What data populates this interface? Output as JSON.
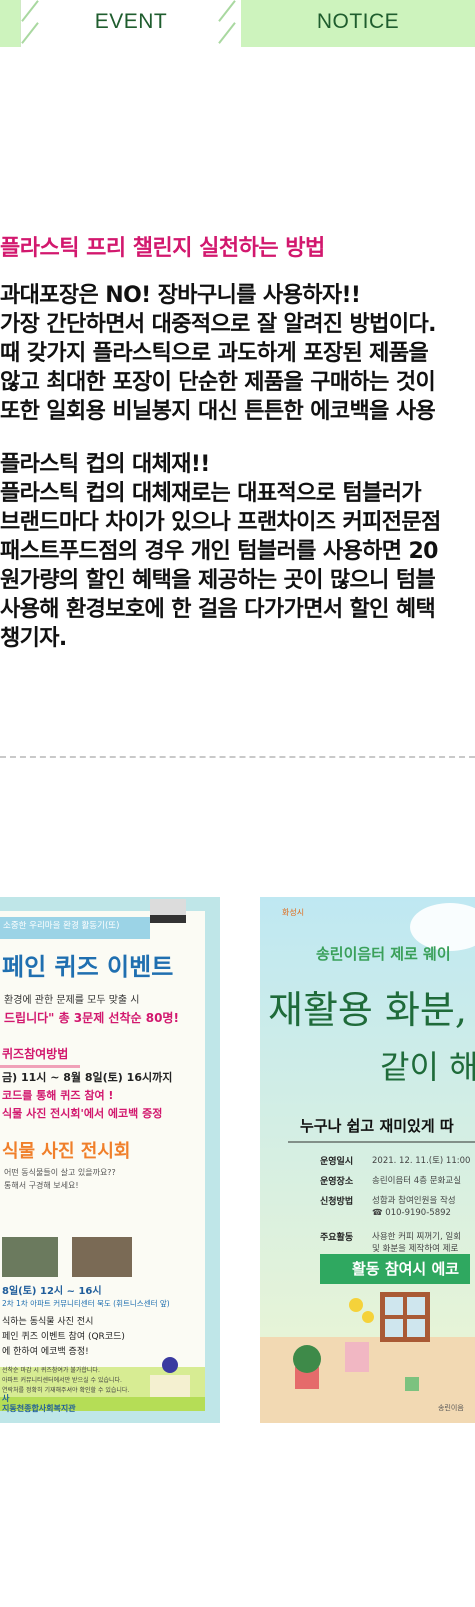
{
  "tabs": [
    {
      "label": "EVENT"
    },
    {
      "label": "NOTICE"
    }
  ],
  "article": {
    "title": "플라스틱 프리 챌린지 실천하는 방법",
    "paragraph1": [
      "과대포장은 NO! 장바구니를 사용하자!!",
      "가장 간단하면서 대중적으로 잘 알려진 방법이다.",
      "때 갖가지 플라스틱으로 과도하게 포장된 제품을",
      "않고 최대한 포장이 단순한 제품을 구매하는 것이",
      "또한 일회용 비닐봉지 대신 튼튼한 에코백을 사용"
    ],
    "paragraph2": [
      "플라스틱 컵의 대체재!!",
      "플라스틱 컵의 대체재로는 대표적으로 텀블러가",
      "브랜드마다 차이가 있으나 프랜차이즈 커피전문점",
      "패스트푸드점의 경우 개인 텀블러를 사용하면 20",
      "원가량의 할인 혜택을 제공하는 곳이 많으니 텀블",
      "사용해 환경보호에 한 걸음 다가가면서 할인 혜택",
      "챙기자."
    ]
  },
  "poster1": {
    "tag": "소중한 우리마을 환경 활동기(또)",
    "headline": "페인 퀴즈 이벤트",
    "line1": "환경에 관한 문제를 모두 맞출 시",
    "line2": "드립니다\" 총 3문제 선착순 80명!",
    "section1": "퀴즈참여방법",
    "item1": "금) 11시 ~ 8월 8일(토) 16시까지",
    "item2": "코드를 통해 퀴즈 참여 !",
    "item3": "식물 사진 전시회'에서 에코백 증정",
    "section2": "식물 사진 전시회",
    "sub1": "어떤 동식물들이 살고 있을까요??",
    "sub2": "통해서 구경해 보세요!",
    "date": "8일(토) 12시 ~ 16시",
    "place": "2차 1차 아파트 커뮤니티센터 북도 (휘트니스센터 앞)",
    "detail1": "식하는 동식물 사진 전시",
    "detail2": "페인 퀴즈 이벤트 참여 (QR코드)",
    "detail3": "에 한하여 에코백 증정!",
    "note1": "선착순 마감 시 퀴즈참여가 불가합니다.",
    "note2": "아파트 커뮤니티센터에서만 받으실 수 있습니다.",
    "note3": "연락처를 정확히 기재해주셔야 확인할 수 있습니다.",
    "org_small": "사",
    "org": "지동천종합사회복지관"
  },
  "poster2": {
    "brand": "화성시",
    "header": "송린이음터 제로 웨이",
    "title1": "재활용 화분,",
    "title2": "같이 해",
    "subtitle": "누구나 쉽고 재미있게 따",
    "rows": [
      {
        "label": "운영일시",
        "value": "2021. 12. 11.(토) 11:00"
      },
      {
        "label": "운영장소",
        "value": "송린이음터 4층 문화교실"
      },
      {
        "label": "신청방법",
        "value": "성함과 참여인원을 작성"
      },
      {
        "label": "",
        "value": "☎ 010-9190-5892"
      },
      {
        "label": "주요활동",
        "value": "사용한 커피 찌꺼기, 일회"
      },
      {
        "label": "",
        "value": "및 화분을 제작하여 제로"
      }
    ],
    "button": "활동 참여시 에코",
    "footer": "송린이음"
  }
}
